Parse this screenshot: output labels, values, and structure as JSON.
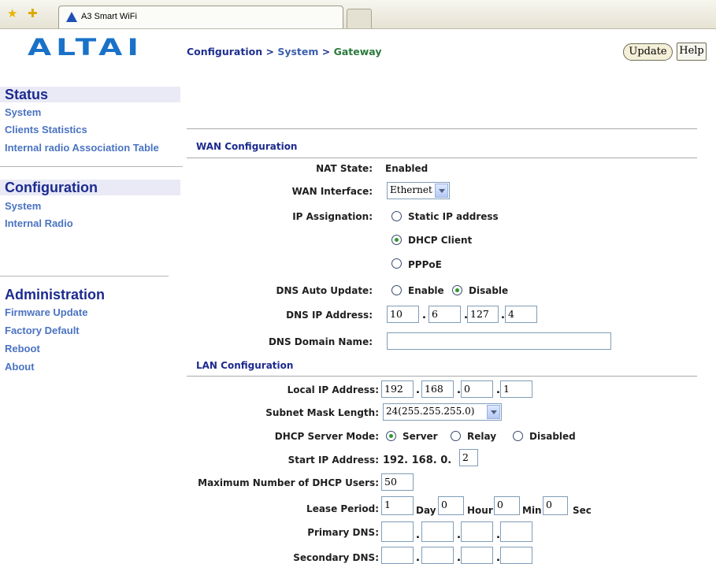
{
  "browser": {
    "tab_title": "A3 Smart WiFi"
  },
  "logo": {
    "text": "ALTAI"
  },
  "breadcrumb": {
    "part1": "Configuration",
    "sep1": " > ",
    "part2": "System",
    "sep2": " > ",
    "part3": "Gateway"
  },
  "buttons": {
    "update": "Update",
    "help": "Help"
  },
  "sidebar": {
    "status_heading": "Status",
    "status_items": [
      "System",
      "Clients Statistics",
      "Internal radio Association Table"
    ],
    "config_heading": "Configuration",
    "config_items": [
      "System",
      "Internal Radio"
    ],
    "admin_heading": "Administration",
    "admin_items": [
      "Firmware Update",
      "Factory Default",
      "Reboot",
      "About"
    ]
  },
  "wan": {
    "title": "WAN Configuration",
    "nat_label": "NAT State:",
    "nat_value": "Enabled",
    "wan_if_label": "WAN Interface:",
    "wan_if_value": "Ethernet",
    "ip_assign_label": "IP Assignation:",
    "ip_options": [
      "Static IP address",
      "DHCP Client",
      "PPPoE"
    ],
    "ip_selected": "DHCP Client",
    "dns_auto_label": "DNS Auto Update:",
    "dns_auto_options": [
      "Enable",
      "Disable"
    ],
    "dns_auto_selected": "Disable",
    "dns_ip_label": "DNS IP Address:",
    "dns_ip": [
      "10",
      "6",
      "127",
      "4"
    ],
    "dns_domain_label": "DNS Domain Name:",
    "dns_domain_value": ""
  },
  "lan": {
    "title": "LAN Configuration",
    "local_ip_label": "Local IP Address:",
    "local_ip": [
      "192",
      "168",
      "0",
      "1"
    ],
    "subnet_label": "Subnet Mask Length:",
    "subnet_value": "24(255.255.255.0)",
    "dhcp_mode_label": "DHCP Server Mode:",
    "dhcp_modes": [
      "Server",
      "Relay",
      "Disabled"
    ],
    "dhcp_mode_selected": "Server",
    "start_ip_label": "Start IP Address:",
    "start_ip_prefix": "192. 168. 0.",
    "start_ip_last": "2",
    "max_users_label": "Maximum Number of DHCP Users:",
    "max_users": "50",
    "lease_label": "Lease Period:",
    "lease": {
      "day": "1",
      "hour": "0",
      "min": "0",
      "sec": "0"
    },
    "lease_units": [
      "Day",
      "Hour",
      "Min",
      "Sec"
    ],
    "primary_dns_label": "Primary DNS:",
    "primary_dns": [
      "",
      "",
      "",
      ""
    ],
    "secondary_dns_label": "Secondary DNS:",
    "secondary_dns": [
      "",
      "",
      "",
      ""
    ]
  },
  "colors": {
    "heading": "#1c2b8f",
    "link": "#4a73c2",
    "logo": "#1a72c8",
    "crumb_current": "#2b7a3b"
  },
  "icons": [
    "favorites-star-icon",
    "add-favorite-icon",
    "altai-tab-icon"
  ]
}
